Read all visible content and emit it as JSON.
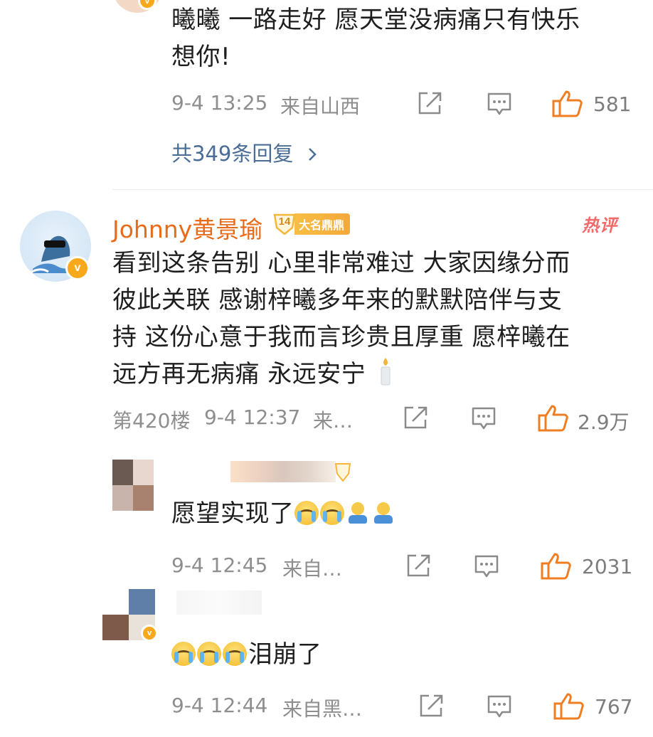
{
  "colors": {
    "username": "#e86b1a",
    "like": "#ef7d22",
    "meta": "#8e8e8e",
    "reply_link": "#4a6d96",
    "vip_badge": "#f5b73b",
    "hot_tag": "#f06a6a"
  },
  "comment1": {
    "text_line1": "曦曦 一路走好 愿天堂没病痛只有快乐",
    "text_line2": "想你!",
    "time": "9-4 13:25",
    "location": "来自山西",
    "likes": "581",
    "replies_link": "共349条回复"
  },
  "comment2": {
    "username": "Johnny黄景瑜",
    "level": "14",
    "vip_label": "大名鼎鼎",
    "hot_label": "热评",
    "text_line1": "看到这条告别 心里非常难过 大家因缘分而",
    "text_line2": "彼此关联 感谢梓曦多年来的默默陪伴与支",
    "text_line3": "持 这份心意于我而言珍贵且厚重 愿梓曦在",
    "text_line4": "远方再无病痛 永远安宁",
    "floor": "第420楼",
    "time": "9-4 12:37",
    "location": "来…",
    "likes": "2.9万"
  },
  "reply1": {
    "text": "愿望实现了",
    "time": "9-4 12:45",
    "location": "来自…",
    "likes": "2031"
  },
  "reply2": {
    "text": "泪崩了",
    "time": "9-4 12:44",
    "location": "来自黑…",
    "likes": "767"
  },
  "icons": {
    "share": "share-icon",
    "comment": "comment-icon",
    "like": "thumbs-up-icon",
    "chevron": "chevron-right-icon",
    "candle": "candle-icon",
    "cry_emoji": "crying-face-icon",
    "hug_emoji": "hug-icon"
  }
}
